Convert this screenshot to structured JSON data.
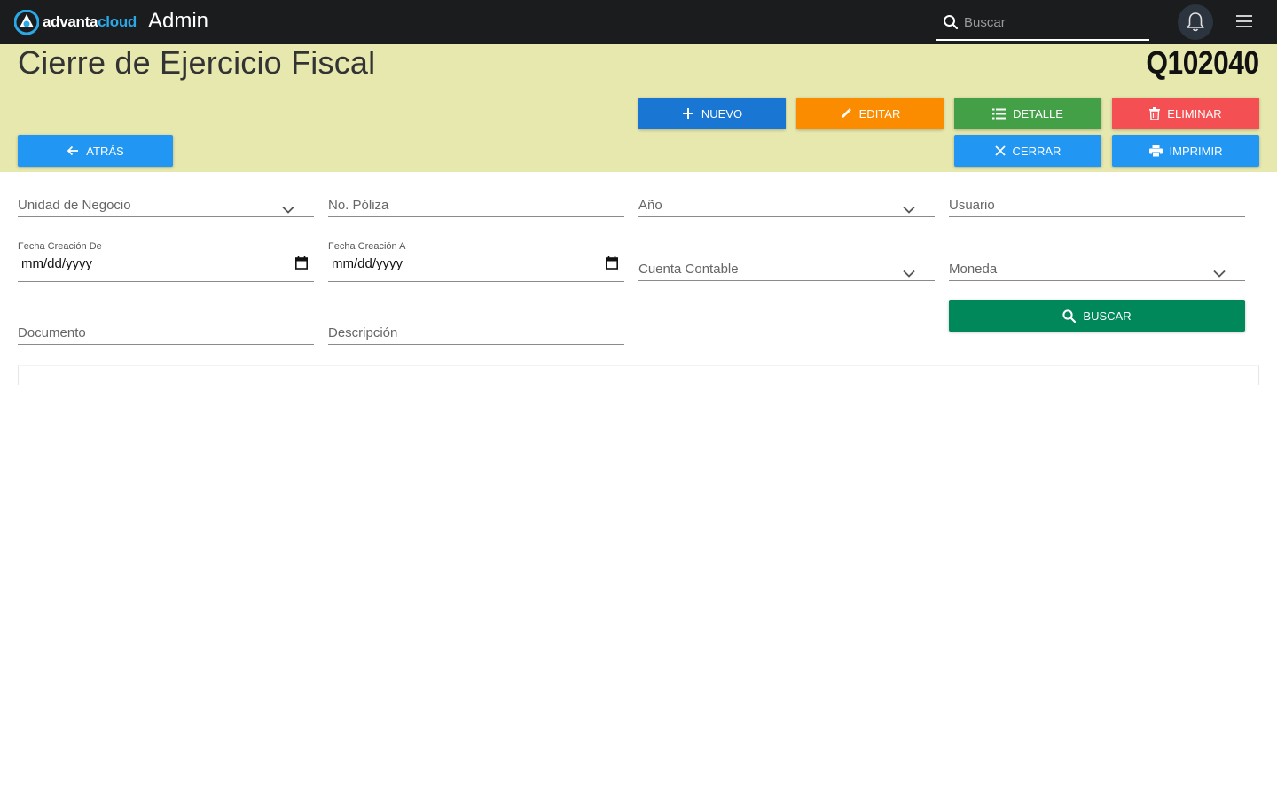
{
  "app": {
    "logo_part1": "advanta",
    "logo_part2": "cloud",
    "title": "Admin",
    "search_placeholder": "Buscar"
  },
  "page": {
    "title": "Cierre de Ejercicio Fiscal",
    "code": "Q102040"
  },
  "toolbar": {
    "nuevo": "NUEVO",
    "editar": "EDITAR",
    "detalle": "DETALLE",
    "eliminar": "ELIMINAR",
    "cerrar": "CERRAR",
    "imprimir": "IMPRIMIR",
    "atras": "ATRÁS"
  },
  "filters": {
    "unidad_negocio": "Unidad de Negocio",
    "no_poliza": "No. Póliza",
    "anio": "Año",
    "usuario": "Usuario",
    "fecha_de_label": "Fecha Creación De",
    "fecha_de_value": "mm/dd/yyyy",
    "fecha_a_label": "Fecha Creación A",
    "fecha_a_value": "mm/dd/yyyy",
    "cuenta_contable": "Cuenta Contable",
    "moneda": "Moneda",
    "documento": "Documento",
    "descripcion": "Descripción",
    "buscar": "BUSCAR"
  },
  "colors": {
    "topbar": "#1b1c1e",
    "band": "#e6e8ae",
    "nuevo": "#1976d2",
    "editar": "#fb8c00",
    "detalle": "#43a047",
    "eliminar": "#f44f52",
    "primary": "#2196f3",
    "buscar": "#00875a"
  }
}
